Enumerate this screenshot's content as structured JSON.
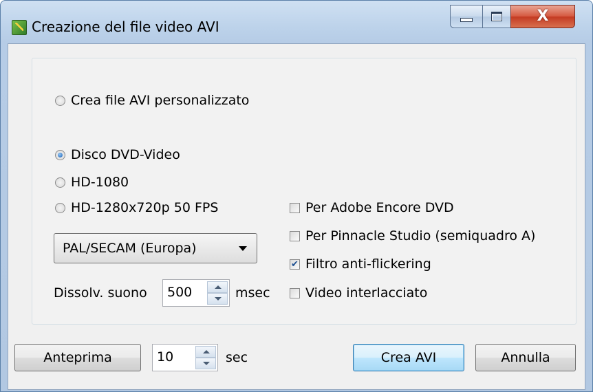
{
  "window": {
    "title": "Creazione del file video AVI",
    "close_glyph": "X"
  },
  "options": {
    "custom_avi": "Crea file AVI personalizzato",
    "dvd_video": "Disco DVD-Video",
    "hd1080": "HD-1080",
    "hd720": "HD-1280x720p 50 FPS",
    "selected": "Disco DVD-Video"
  },
  "region": {
    "selected": "PAL/SECAM (Europa)"
  },
  "sound_fade": {
    "label": "Dissolv. suono",
    "value": "500",
    "unit": "msec"
  },
  "checkboxes": {
    "adobe": {
      "label": "Per Adobe Encore DVD",
      "checked": false
    },
    "pinnacle": {
      "label": "Per Pinnacle Studio (semiquadro A)",
      "checked": false
    },
    "flicker": {
      "label": "Filtro anti-flickering",
      "checked": true
    },
    "interlaced": {
      "label": "Video interlacciato",
      "checked": false
    }
  },
  "footer": {
    "preview_label": "Anteprima",
    "preview_seconds": "10",
    "seconds_unit": "sec",
    "create_label": "Crea AVI",
    "cancel_label": "Annulla"
  },
  "icons": {
    "app": "app-icon",
    "minimize": "minimize-icon",
    "maximize": "maximize-icon",
    "close": "close-icon",
    "dropdown": "chevron-down-icon",
    "spin_up": "spin-up-icon",
    "spin_down": "spin-down-icon"
  },
  "colors": {
    "titlebar": "#bcd2ea",
    "close_button": "#c33a22",
    "default_button": "#bee6fd",
    "dialog_background": "#f0f0f0"
  }
}
